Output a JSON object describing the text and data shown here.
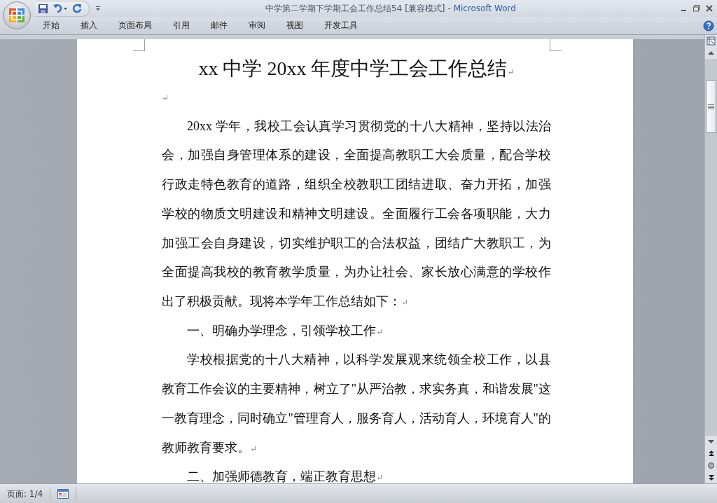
{
  "window": {
    "title": "中学第二学期下学期工会工作总结54 [兼容模式]",
    "app_name": "- Microsoft Word"
  },
  "ribbon": {
    "tabs": [
      {
        "label": "开始",
        "selected": false
      },
      {
        "label": "插入",
        "selected": false
      },
      {
        "label": "页面布局",
        "selected": false
      },
      {
        "label": "引用",
        "selected": false
      },
      {
        "label": "邮件",
        "selected": false
      },
      {
        "label": "审阅",
        "selected": false
      },
      {
        "label": "视图",
        "selected": false
      },
      {
        "label": "开发工具",
        "selected": false
      }
    ]
  },
  "document": {
    "title": "xx 中学 20xx 年度中学工会工作总结",
    "title_mark": "↵",
    "paragraphs": [
      {
        "kind": "empty",
        "mark": "↵"
      },
      {
        "kind": "body",
        "text": "20xx 学年，我校工会认真学习贯彻党的十八大精神，坚持以法治会，加强自身管理体系的建设，全面提高教职工大会质量，配合学校行政走特色教育的道路，组织全校教职工团结进取、奋力开拓，加强学校的物质文明建设和精神文明建设。全面履行工会各项职能，大力加强工会自身建设，切实维护职工的合法权益，团结广大教职工，为全面提高我校的教育教学质量，为办让社会、家长放心满意的学校作出了积极贡献。现将本学年工作总结如下：",
        "mark": "↵"
      },
      {
        "kind": "heading",
        "text": "一、明确办学理念，引领学校工作",
        "mark": "↵"
      },
      {
        "kind": "body",
        "text": "学校根据党的十八大精神，以科学发展观来统领全校工作，以县教育工作会议的主要精神，树立了\"从严治教，求实务真，和谐发展\"这一教育理念，同时确立\"管理育人，服务育人，活动育人，环境育人\"的教师教育要求。",
        "mark": "↵"
      },
      {
        "kind": "heading",
        "text": "二、加强师德教育，端正教育思想",
        "mark": "↵"
      }
    ]
  },
  "status_bar": {
    "page": "页面: 1/4"
  }
}
